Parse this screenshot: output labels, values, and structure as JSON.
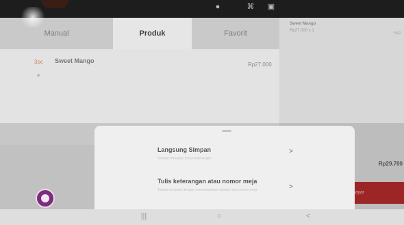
{
  "tabs": [
    {
      "label": "Manual"
    },
    {
      "label": "Produk"
    },
    {
      "label": "Favorit"
    }
  ],
  "product": {
    "qty": "3pc",
    "name": "Sweet Mango",
    "price": "Rp27.000"
  },
  "cart": {
    "item_name": "Sweet Mango",
    "item_detail": "Rp27.000 x 1",
    "item_right": "Rp2",
    "total": "Rp29.700",
    "pay_label": "Bayar"
  },
  "sheet": {
    "options": [
      {
        "title": "Langsung Simpan",
        "desc": "Simpan transaksi tanpa keterangan",
        "chevron": ">"
      },
      {
        "title": "Tulis keterangan atau nomor meja",
        "desc": "Tandai transaksi dengan menambahkan catatan atau nomor meja",
        "chevron": ">"
      }
    ]
  },
  "navbar": {
    "recent": "|||",
    "home": "○",
    "back": "<"
  },
  "colors": {
    "accent": "#b12626",
    "fab": "#7d2c7c"
  }
}
